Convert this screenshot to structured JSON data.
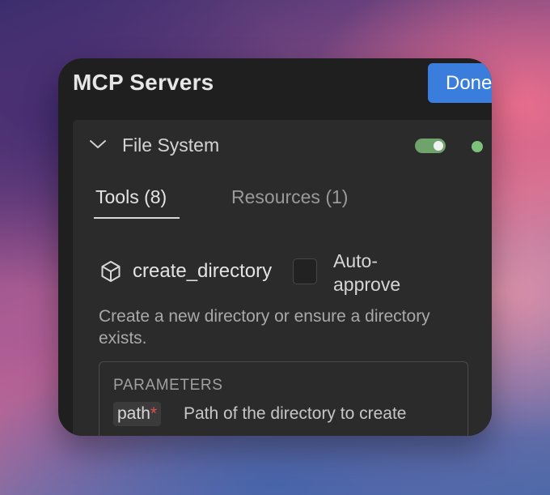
{
  "header": {
    "title": "MCP Servers",
    "done_label": "Done"
  },
  "server": {
    "name": "File System",
    "enabled": true,
    "status_color": "#7dc27b",
    "toggle_color": "#6ea36b"
  },
  "tabs": [
    {
      "label": "Tools (8)",
      "active": true
    },
    {
      "label": "Resources (1)",
      "active": false
    }
  ],
  "tool": {
    "icon": "cube-icon",
    "name": "create_directory",
    "auto_approve_label": "Auto-approve",
    "auto_approve_checked": false,
    "description": "Create a new directory or ensure a directory exists.",
    "parameters_heading": "PARAMETERS",
    "parameters": [
      {
        "name": "path",
        "required_mark": "*",
        "description": "Path of the directory to create"
      }
    ]
  },
  "colors": {
    "accent": "#3b7ddd",
    "required": "#e0524c"
  }
}
